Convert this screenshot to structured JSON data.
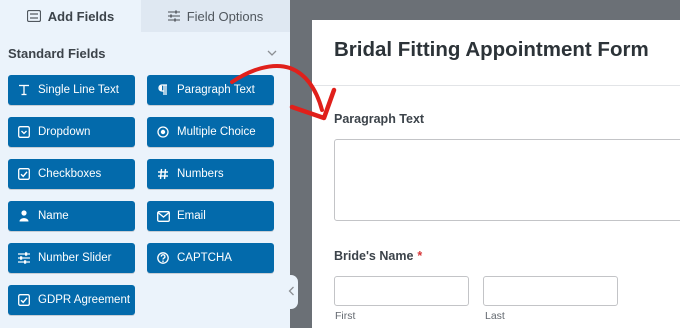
{
  "tabs": {
    "add_fields": "Add Fields",
    "field_options": "Field Options"
  },
  "section": {
    "title": "Standard Fields"
  },
  "fields": [
    {
      "label": "Single Line Text",
      "icon": "text-cursor-icon"
    },
    {
      "label": "Paragraph Text",
      "icon": "paragraph-icon"
    },
    {
      "label": "Dropdown",
      "icon": "dropdown-icon"
    },
    {
      "label": "Multiple Choice",
      "icon": "radio-icon"
    },
    {
      "label": "Checkboxes",
      "icon": "checkbox-icon"
    },
    {
      "label": "Numbers",
      "icon": "hash-icon"
    },
    {
      "label": "Name",
      "icon": "user-icon"
    },
    {
      "label": "Email",
      "icon": "envelope-icon"
    },
    {
      "label": "Number Slider",
      "icon": "sliders-icon"
    },
    {
      "label": "CAPTCHA",
      "icon": "question-circle-icon"
    },
    {
      "label": "GDPR Agreement",
      "icon": "checkbox-icon"
    }
  ],
  "form": {
    "title": "Bridal Fitting Appointment Form",
    "paragraph_label": "Paragraph Text",
    "brides_name_label": "Bride's Name",
    "required_marker": "*",
    "first_sublabel": "First",
    "last_sublabel": "Last"
  },
  "colors": {
    "field_button": "#036aab",
    "panel_bg": "#ebf3fb",
    "preview_bg": "#6b7076",
    "arrow": "#e0201b",
    "required": "#d63638"
  }
}
